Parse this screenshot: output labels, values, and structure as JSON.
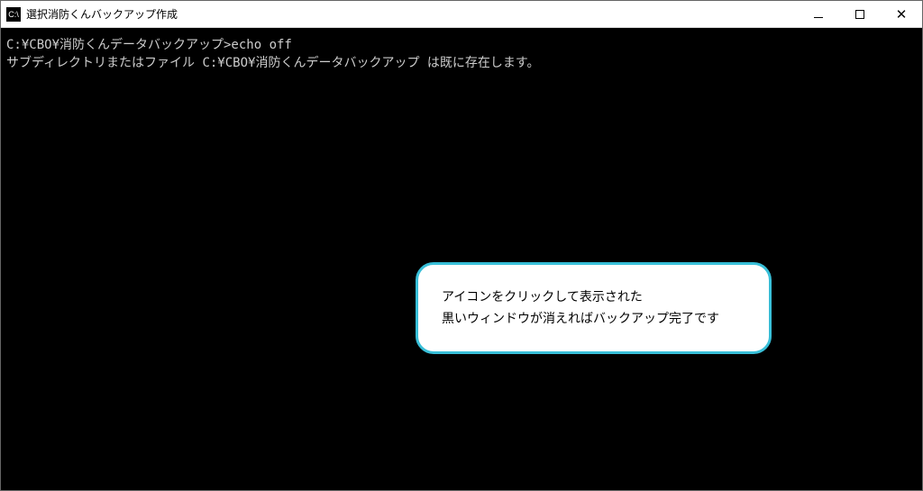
{
  "titlebar": {
    "icon_label": "C:\\",
    "title": "選択消防くんバックアップ作成"
  },
  "console": {
    "line1": "C:¥CBO¥消防くんデータバックアップ>echo off",
    "line2": "サブディレクトリまたはファイル C:¥CBO¥消防くんデータバックアップ は既に存在します。"
  },
  "callout": {
    "line1": "アイコンをクリックして表示された",
    "line2": "黒いウィンドウが消えればバックアップ完了です"
  }
}
